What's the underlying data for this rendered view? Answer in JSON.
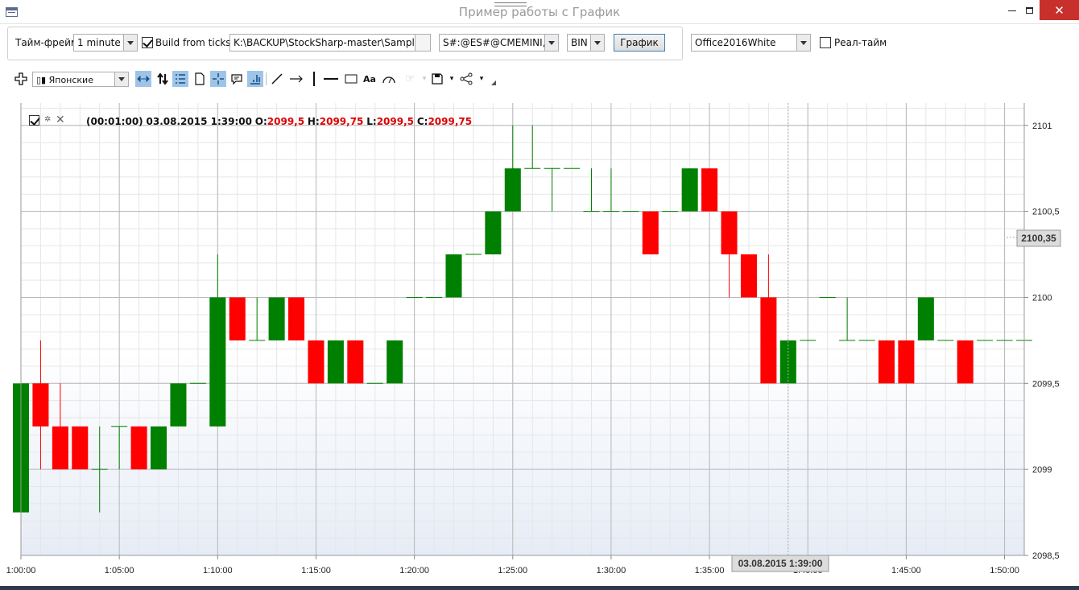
{
  "window": {
    "title": "Пример работы с График"
  },
  "toolbar": {
    "timeframe_label": "Тайм-фрейм",
    "timeframe_value": "1 minute",
    "build_from_ticks_label": "Build from ticks",
    "build_from_ticks_checked": true,
    "path_value": "K:\\BACKUP\\StockSharp-master\\Samples\\T",
    "security_value": "S#:@ES#@CMEMINI, N",
    "format_value": "BIN",
    "chart_button": "График",
    "theme_value": "Office2016White",
    "realtime_label": "Реал-тайм",
    "realtime_checked": false
  },
  "chart_toolbar": {
    "style_value": "Японские",
    "tools": [
      "move-icon",
      "candle-style-icon",
      "pan-icon",
      "autoscale-icon",
      "list-icon",
      "page-icon",
      "crosshair-icon",
      "comment-icon",
      "chart-snap-icon",
      "line-icon",
      "arrow-icon",
      "vline-icon",
      "hline-icon",
      "rectangle-icon",
      "text-icon",
      "ruler-icon",
      "pointer-icon",
      "save-icon",
      "share-icon"
    ]
  },
  "legend": {
    "timeframe": "(00:01:00)",
    "datetime": "03.08.2015 1:39:00",
    "o_label": "O:",
    "o_value": "2099,5",
    "h_label": "H:",
    "h_value": "2099,75",
    "l_label": "L:",
    "l_value": "2099,5",
    "c_label": "C:",
    "c_value": "2099,75"
  },
  "cursor": {
    "price_label": "2100,35",
    "time_label": "03.08.2015 1:39:00"
  },
  "colors": {
    "up": "#008000",
    "down": "#ff0000",
    "grid": "#c8c8c8",
    "background_bottom": "#e6ecf6"
  },
  "chart_data": {
    "type": "candlestick",
    "x_tick_labels": [
      "1:00:00",
      "1:05:00",
      "1:10:00",
      "1:15:00",
      "1:20:00",
      "1:25:00",
      "1:30:00",
      "1:35:00",
      "1:40:00",
      "1:45:00",
      "1:50:00"
    ],
    "y_tick_labels": [
      "2101",
      "2100,5",
      "2100",
      "2099,5",
      "2099",
      "2098,5"
    ],
    "y_ticks": [
      2101,
      2100.5,
      2100,
      2099.5,
      2099,
      2098.5
    ],
    "ylim": [
      2098.5,
      2101.13
    ],
    "x_minutes_range": [
      0,
      51
    ],
    "grid": true,
    "candles": [
      {
        "t": "1:00",
        "o": 2098.75,
        "h": 2099.75,
        "l": 2098.5,
        "c": 2099.5
      },
      {
        "t": "1:01",
        "o": 2099.5,
        "h": 2099.75,
        "l": 2099.0,
        "c": 2099.25
      },
      {
        "t": "1:02",
        "o": 2099.25,
        "h": 2099.5,
        "l": 2099.0,
        "c": 2099.0
      },
      {
        "t": "1:03",
        "o": 2099.25,
        "h": 2099.25,
        "l": 2099.0,
        "c": 2099.0
      },
      {
        "t": "1:04",
        "o": 2099.0,
        "h": 2099.25,
        "l": 2098.75,
        "c": 2099.0
      },
      {
        "t": "1:05",
        "o": 2099.25,
        "h": 2099.25,
        "l": 2099.0,
        "c": 2099.25
      },
      {
        "t": "1:06",
        "o": 2099.25,
        "h": 2099.25,
        "l": 2099.0,
        "c": 2099.0
      },
      {
        "t": "1:07",
        "o": 2099.0,
        "h": 2099.25,
        "l": 2099.0,
        "c": 2099.25
      },
      {
        "t": "1:08",
        "o": 2099.25,
        "h": 2099.5,
        "l": 2099.25,
        "c": 2099.5
      },
      {
        "t": "1:09",
        "o": 2099.5,
        "h": 2099.5,
        "l": 2099.5,
        "c": 2099.5
      },
      {
        "t": "1:10",
        "o": 2099.25,
        "h": 2100.25,
        "l": 2099.25,
        "c": 2100.0
      },
      {
        "t": "1:11",
        "o": 2100.0,
        "h": 2100.0,
        "l": 2099.75,
        "c": 2099.75
      },
      {
        "t": "1:12",
        "o": 2099.75,
        "h": 2100.0,
        "l": 2099.75,
        "c": 2099.75
      },
      {
        "t": "1:13",
        "o": 2099.75,
        "h": 2100.0,
        "l": 2099.75,
        "c": 2100.0
      },
      {
        "t": "1:14",
        "o": 2100.0,
        "h": 2100.0,
        "l": 2099.75,
        "c": 2099.75
      },
      {
        "t": "1:15",
        "o": 2099.75,
        "h": 2099.75,
        "l": 2099.5,
        "c": 2099.5
      },
      {
        "t": "1:16",
        "o": 2099.5,
        "h": 2099.75,
        "l": 2099.5,
        "c": 2099.75
      },
      {
        "t": "1:17",
        "o": 2099.75,
        "h": 2099.75,
        "l": 2099.5,
        "c": 2099.5
      },
      {
        "t": "1:18",
        "o": 2099.5,
        "h": 2099.5,
        "l": 2099.5,
        "c": 2099.5
      },
      {
        "t": "1:19",
        "o": 2099.5,
        "h": 2099.75,
        "l": 2099.5,
        "c": 2099.75
      },
      {
        "t": "1:20",
        "o": 2100.0,
        "h": 2100.0,
        "l": 2100.0,
        "c": 2100.0
      },
      {
        "t": "1:21",
        "o": 2100.0,
        "h": 2100.0,
        "l": 2100.0,
        "c": 2100.0
      },
      {
        "t": "1:22",
        "o": 2100.0,
        "h": 2100.25,
        "l": 2100.0,
        "c": 2100.25
      },
      {
        "t": "1:23",
        "o": 2100.25,
        "h": 2100.25,
        "l": 2100.25,
        "c": 2100.25
      },
      {
        "t": "1:24",
        "o": 2100.25,
        "h": 2100.5,
        "l": 2100.25,
        "c": 2100.5
      },
      {
        "t": "1:25",
        "o": 2100.5,
        "h": 2101.0,
        "l": 2100.5,
        "c": 2100.75
      },
      {
        "t": "1:26",
        "o": 2100.75,
        "h": 2101.0,
        "l": 2100.75,
        "c": 2100.75
      },
      {
        "t": "1:27",
        "o": 2100.75,
        "h": 2100.75,
        "l": 2100.5,
        "c": 2100.75
      },
      {
        "t": "1:28",
        "o": 2100.75,
        "h": 2100.75,
        "l": 2100.75,
        "c": 2100.75
      },
      {
        "t": "1:29",
        "o": 2100.5,
        "h": 2100.75,
        "l": 2100.5,
        "c": 2100.5
      },
      {
        "t": "1:30",
        "o": 2100.5,
        "h": 2100.75,
        "l": 2100.5,
        "c": 2100.5
      },
      {
        "t": "1:31",
        "o": 2100.5,
        "h": 2100.5,
        "l": 2100.5,
        "c": 2100.5
      },
      {
        "t": "1:32",
        "o": 2100.5,
        "h": 2100.5,
        "l": 2100.25,
        "c": 2100.25
      },
      {
        "t": "1:33",
        "o": 2100.5,
        "h": 2100.5,
        "l": 2100.5,
        "c": 2100.5
      },
      {
        "t": "1:34",
        "o": 2100.5,
        "h": 2100.75,
        "l": 2100.5,
        "c": 2100.75
      },
      {
        "t": "1:35",
        "o": 2100.75,
        "h": 2100.75,
        "l": 2100.5,
        "c": 2100.5
      },
      {
        "t": "1:36",
        "o": 2100.5,
        "h": 2100.5,
        "l": 2100.0,
        "c": 2100.25
      },
      {
        "t": "1:37",
        "o": 2100.25,
        "h": 2100.25,
        "l": 2100.0,
        "c": 2100.0
      },
      {
        "t": "1:38",
        "o": 2100.0,
        "h": 2100.25,
        "l": 2099.5,
        "c": 2099.5
      },
      {
        "t": "1:39",
        "o": 2099.5,
        "h": 2099.75,
        "l": 2099.5,
        "c": 2099.75
      },
      {
        "t": "1:40",
        "o": 2099.75,
        "h": 2099.75,
        "l": 2099.75,
        "c": 2099.75
      },
      {
        "t": "1:41",
        "o": 2100.0,
        "h": 2100.0,
        "l": 2100.0,
        "c": 2100.0
      },
      {
        "t": "1:42",
        "o": 2099.75,
        "h": 2100.0,
        "l": 2099.75,
        "c": 2099.75
      },
      {
        "t": "1:43",
        "o": 2099.75,
        "h": 2099.75,
        "l": 2099.75,
        "c": 2099.75
      },
      {
        "t": "1:44",
        "o": 2099.75,
        "h": 2099.75,
        "l": 2099.5,
        "c": 2099.5
      },
      {
        "t": "1:45",
        "o": 2099.75,
        "h": 2099.75,
        "l": 2099.5,
        "c": 2099.5
      },
      {
        "t": "1:46",
        "o": 2099.75,
        "h": 2100.0,
        "l": 2099.75,
        "c": 2100.0
      },
      {
        "t": "1:47",
        "o": 2099.75,
        "h": 2099.75,
        "l": 2099.75,
        "c": 2099.75
      },
      {
        "t": "1:48",
        "o": 2099.75,
        "h": 2099.75,
        "l": 2099.5,
        "c": 2099.5
      },
      {
        "t": "1:49",
        "o": 2099.75,
        "h": 2099.75,
        "l": 2099.75,
        "c": 2099.75
      },
      {
        "t": "1:50",
        "o": 2099.75,
        "h": 2099.75,
        "l": 2099.75,
        "c": 2099.75
      },
      {
        "t": "1:51",
        "o": 2099.75,
        "h": 2100.0,
        "l": 2099.75,
        "c": 2099.75
      }
    ]
  }
}
